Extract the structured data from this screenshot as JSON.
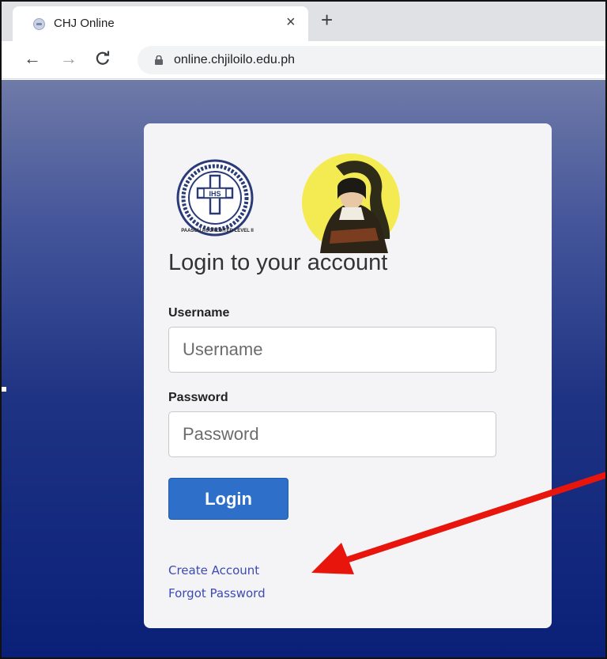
{
  "browser": {
    "tab_title": "CHJ Online",
    "tab_close": "×",
    "new_tab": "+",
    "back": "←",
    "forward": "→",
    "reload": "C",
    "url": "online.chjiloilo.edu.ph"
  },
  "login": {
    "accreditation": "PAASCU ACCREDITED LEVEL II",
    "heading": "Login to your account",
    "username_label": "Username",
    "username_placeholder": "Username",
    "password_label": "Password",
    "password_placeholder": "Password",
    "login_button": "Login",
    "create_account": "Create Account",
    "forgot_password": "Forgot Password"
  },
  "colors": {
    "accent_button": "#2d6fc9",
    "link": "#3b4bb3",
    "annotation_arrow": "#e8150d"
  },
  "icons": [
    "favicon-icon",
    "close-icon",
    "plus-icon",
    "back-arrow-icon",
    "forward-arrow-icon",
    "reload-icon",
    "lock-icon",
    "school-seal-logo",
    "founder-portrait-logo"
  ]
}
